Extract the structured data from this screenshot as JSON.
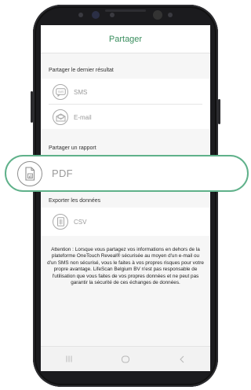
{
  "app": {
    "title": "Partager"
  },
  "sections": {
    "share_last_result": {
      "title": "Partager le dernier résultat",
      "items": [
        {
          "label": "SMS",
          "icon": "sms-icon"
        },
        {
          "label": "E-mail",
          "icon": "email-icon"
        }
      ]
    },
    "share_report": {
      "title": "Partager un rapport",
      "items": [
        {
          "label": "PDF",
          "icon": "pdf-document-icon"
        }
      ]
    },
    "export_data": {
      "title": "Exporter les données",
      "items": [
        {
          "label": "CSV",
          "icon": "csv-file-icon"
        }
      ]
    }
  },
  "attention_text": "Attention : Lorsque vous partagez vos informations en dehors de la plateforme OneTouch Reveal® sécurisée au moyen d'un e-mail ou d'un SMS non sécurisé, vous le faites à vos propres risques pour votre propre avantage. LifeScan Belgium BV n'est pas responsable de l'utilisation que vous faites de vos propres données et ne peut pas garantir la sécurité de ces échanges de données.",
  "navbar": {
    "recents": "|||",
    "home": "○",
    "back": "<"
  },
  "colors": {
    "accent": "#3a8e5e",
    "highlight_border": "#5fb18a"
  }
}
